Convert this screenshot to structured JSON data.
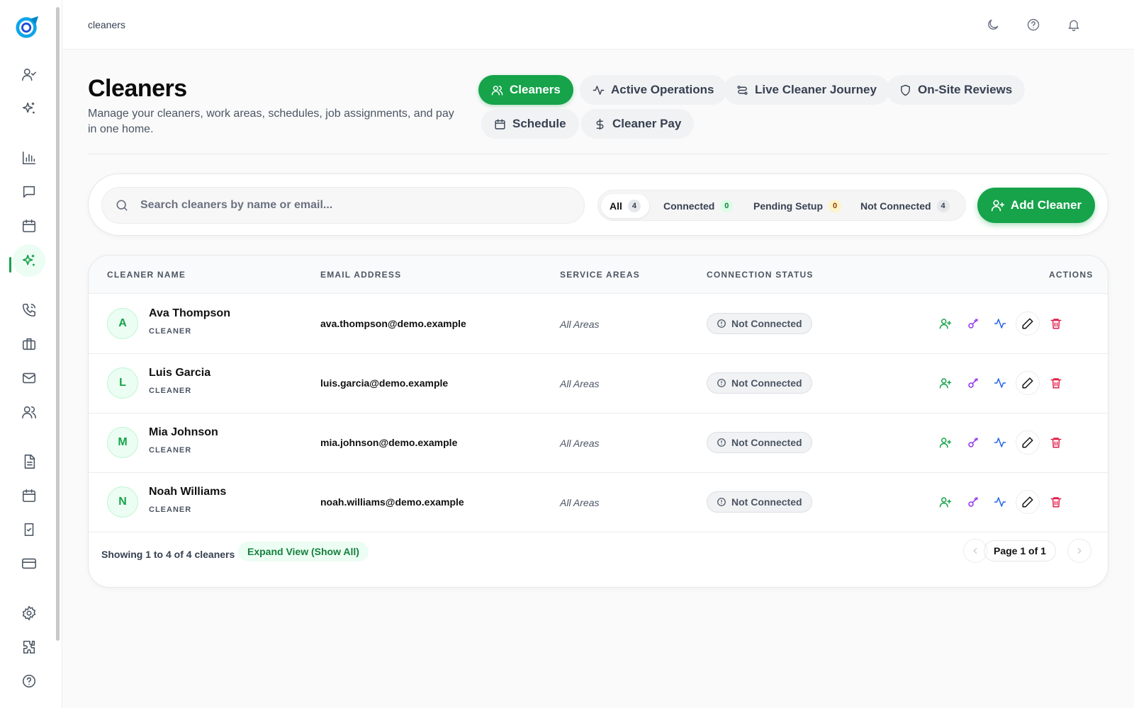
{
  "topbar": {
    "breadcrumb": "cleaners",
    "icons": [
      "moon-icon",
      "help-icon",
      "bell-icon"
    ]
  },
  "sidebar": {
    "items": [
      {
        "name": "user-check",
        "active": false
      },
      {
        "name": "sparkles",
        "active": false
      },
      {
        "name": "bar-chart",
        "active": false
      },
      {
        "name": "message",
        "active": false
      },
      {
        "name": "calendar",
        "active": false
      },
      {
        "name": "sparkles",
        "active": true
      },
      {
        "name": "phone",
        "active": false
      },
      {
        "name": "briefcase",
        "active": false
      },
      {
        "name": "mail",
        "active": false
      },
      {
        "name": "users",
        "active": false
      },
      {
        "name": "document",
        "active": false
      },
      {
        "name": "calendar",
        "active": false
      },
      {
        "name": "clipboard-check",
        "active": false
      },
      {
        "name": "credit-card",
        "active": false
      },
      {
        "name": "settings",
        "active": false
      },
      {
        "name": "puzzle",
        "active": false
      },
      {
        "name": "help",
        "active": false
      }
    ]
  },
  "header": {
    "title": "Cleaners",
    "description": "Manage your cleaners, work areas, schedules, job assignments, and pay in one home."
  },
  "tabs": [
    {
      "label": "Cleaners",
      "icon": "users-icon",
      "active": true
    },
    {
      "label": "Active Operations",
      "icon": "activity-icon",
      "active": false
    },
    {
      "label": "Live Cleaner Journey",
      "icon": "route-icon",
      "active": false
    },
    {
      "label": "On-Site Reviews",
      "icon": "shield-icon",
      "active": false
    },
    {
      "label": "Schedule",
      "icon": "calendar-icon",
      "active": false
    },
    {
      "label": "Cleaner Pay",
      "icon": "dollar-icon",
      "active": false
    }
  ],
  "search": {
    "placeholder": "Search cleaners by name or email..."
  },
  "filters": [
    {
      "label": "All",
      "count": "4",
      "active": true
    },
    {
      "label": "Connected",
      "count": "0",
      "active": false
    },
    {
      "label": "Pending Setup",
      "count": "0",
      "active": false
    },
    {
      "label": "Not Connected",
      "count": "4",
      "active": false
    }
  ],
  "add_button": {
    "label": "Add Cleaner"
  },
  "table": {
    "columns": [
      "CLEANER NAME",
      "EMAIL ADDRESS",
      "SERVICE AREAS",
      "CONNECTION STATUS",
      "ACTIONS"
    ],
    "rows": [
      {
        "initial": "A",
        "name": "Ava Thompson",
        "role": "CLEANER",
        "email": "ava.thompson@demo.example",
        "areas": "All Areas",
        "status": "Not Connected"
      },
      {
        "initial": "L",
        "name": "Luis Garcia",
        "role": "CLEANER",
        "email": "luis.garcia@demo.example",
        "areas": "All Areas",
        "status": "Not Connected"
      },
      {
        "initial": "M",
        "name": "Mia Johnson",
        "role": "CLEANER",
        "email": "mia.johnson@demo.example",
        "areas": "All Areas",
        "status": "Not Connected"
      },
      {
        "initial": "N",
        "name": "Noah Williams",
        "role": "CLEANER",
        "email": "noah.williams@demo.example",
        "areas": "All Areas",
        "status": "Not Connected"
      }
    ]
  },
  "footer": {
    "showing": "Showing 1 to 4 of 4 cleaners",
    "expand": "Expand View (Show All)",
    "page": "Page 1 of 1"
  },
  "colors": {
    "accent": "#16a34a",
    "invite": "#16a34a",
    "key": "#9333ea",
    "activity": "#2563eb",
    "delete": "#e11d48"
  }
}
